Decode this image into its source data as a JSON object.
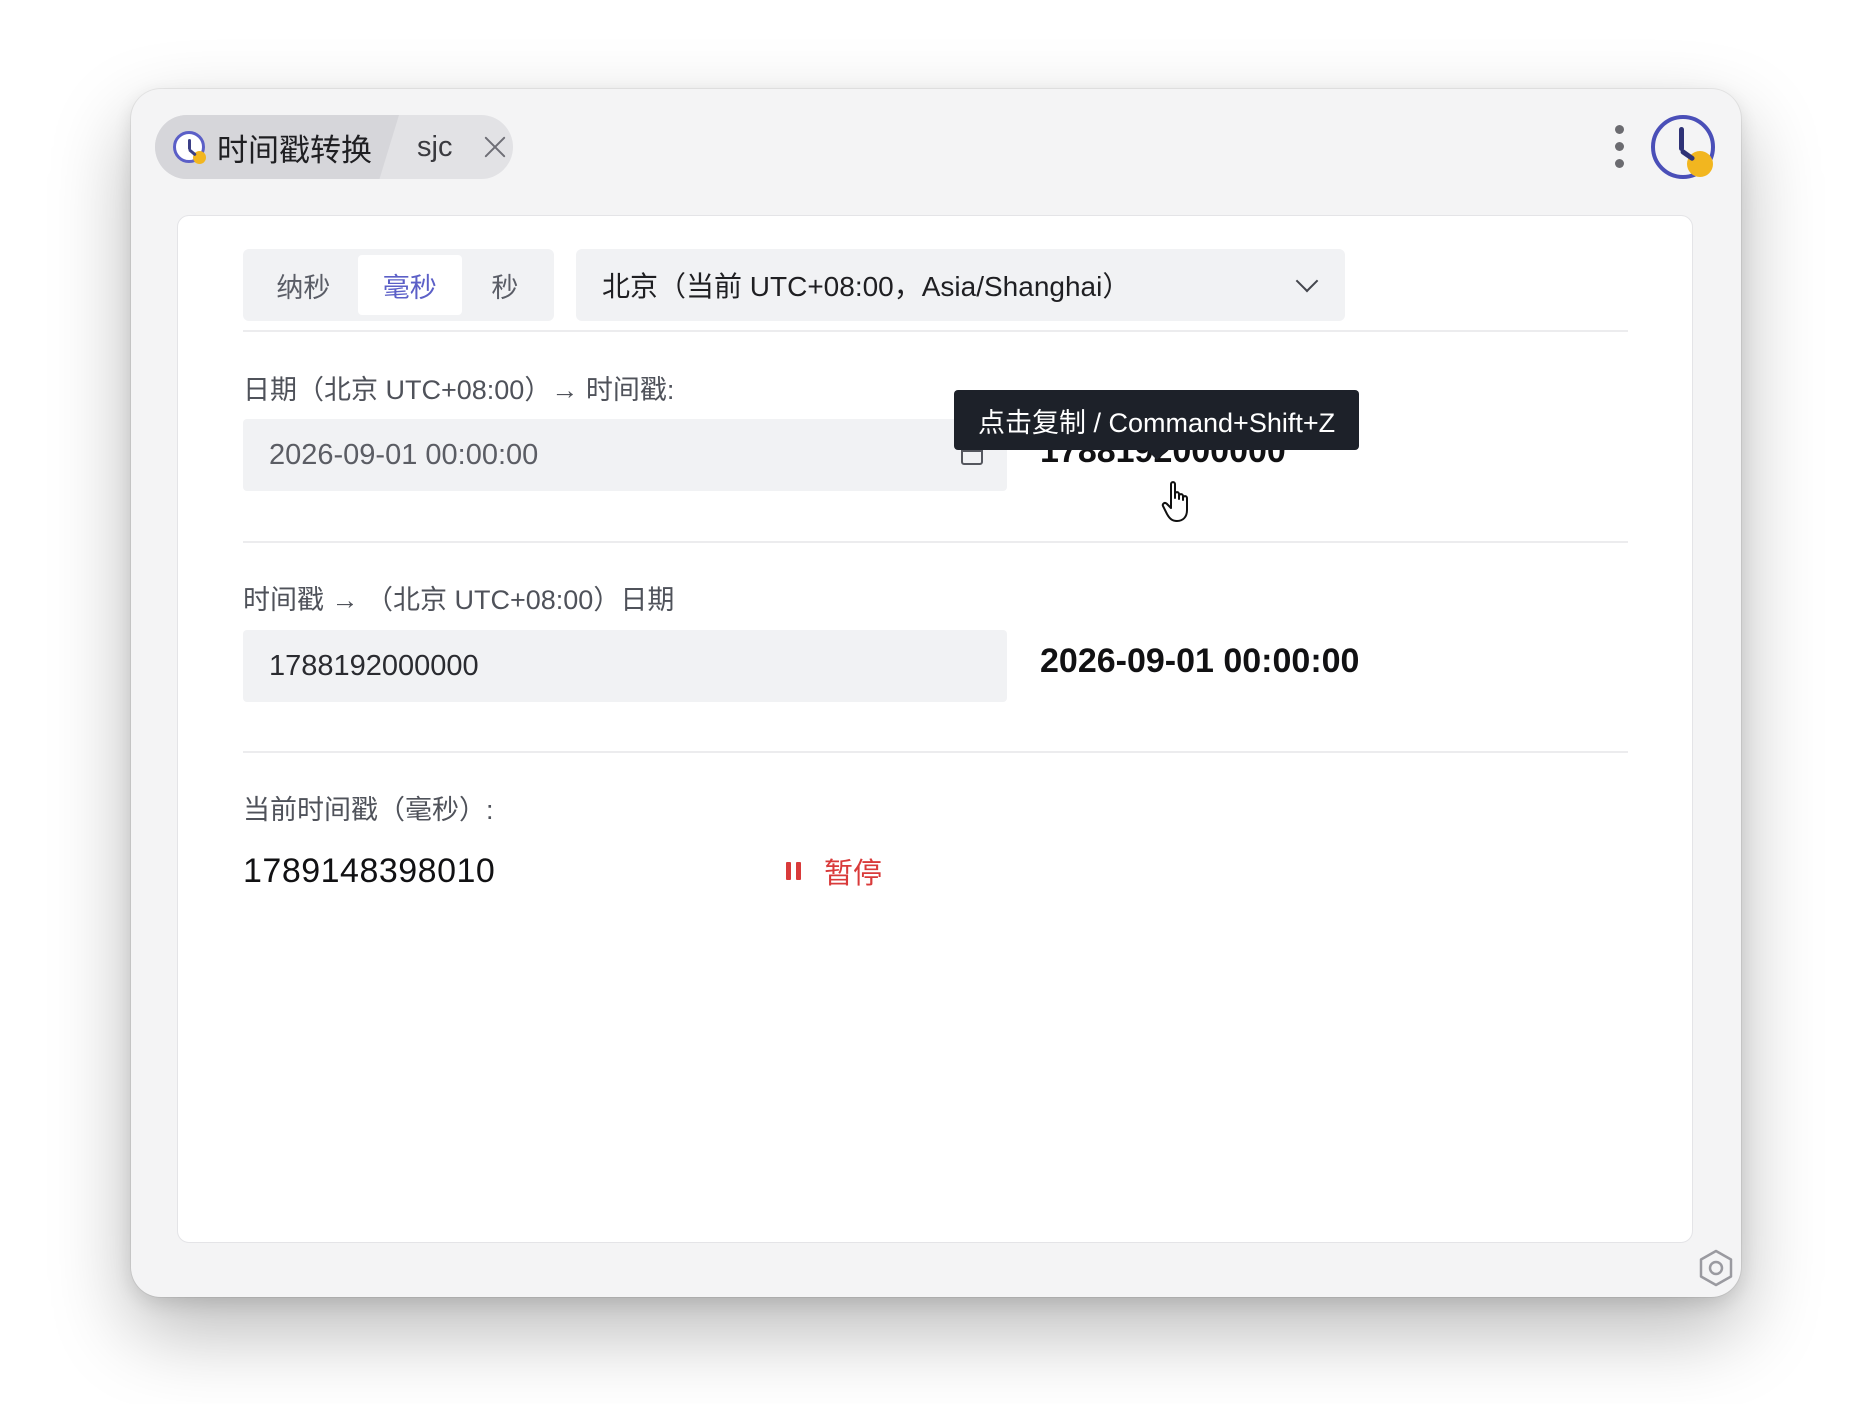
{
  "tab": {
    "title": "时间戳转换",
    "subtitle": "sjc"
  },
  "units": {
    "options": [
      "纳秒",
      "毫秒",
      "秒"
    ],
    "selected": "毫秒"
  },
  "timezone": {
    "selected": "北京（当前 UTC+08:00，Asia/Shanghai）"
  },
  "date_to_ts": {
    "label": "日期（北京 UTC+08:00）→ 时间戳:",
    "input_value": "2026-09-01 00:00:00",
    "result": "1788192000000",
    "tooltip": "点击复制 / Command+Shift+Z"
  },
  "ts_to_date": {
    "label": "时间戳 → （北京 UTC+08:00）日期",
    "input_value": "1788192000000",
    "result": "2026-09-01 00:00:00"
  },
  "current": {
    "label": "当前时间戳（毫秒）:",
    "value": "1789148398010",
    "pause_label": "暂停"
  },
  "colors": {
    "accent": "#5b5fc7",
    "pause": "#d93a3a",
    "tooltip_bg": "#1d2129",
    "icon_sun": "#f2b61f"
  },
  "icons": {
    "tab_icon": "clock-icon",
    "close": "close-icon",
    "more": "more-vertical-icon",
    "app": "app-clock-icon",
    "dropdown": "chevron-down-icon",
    "calendar": "calendar-icon",
    "pause": "pause-icon",
    "cursor": "hand-pointer-icon",
    "settings": "settings-icon"
  }
}
